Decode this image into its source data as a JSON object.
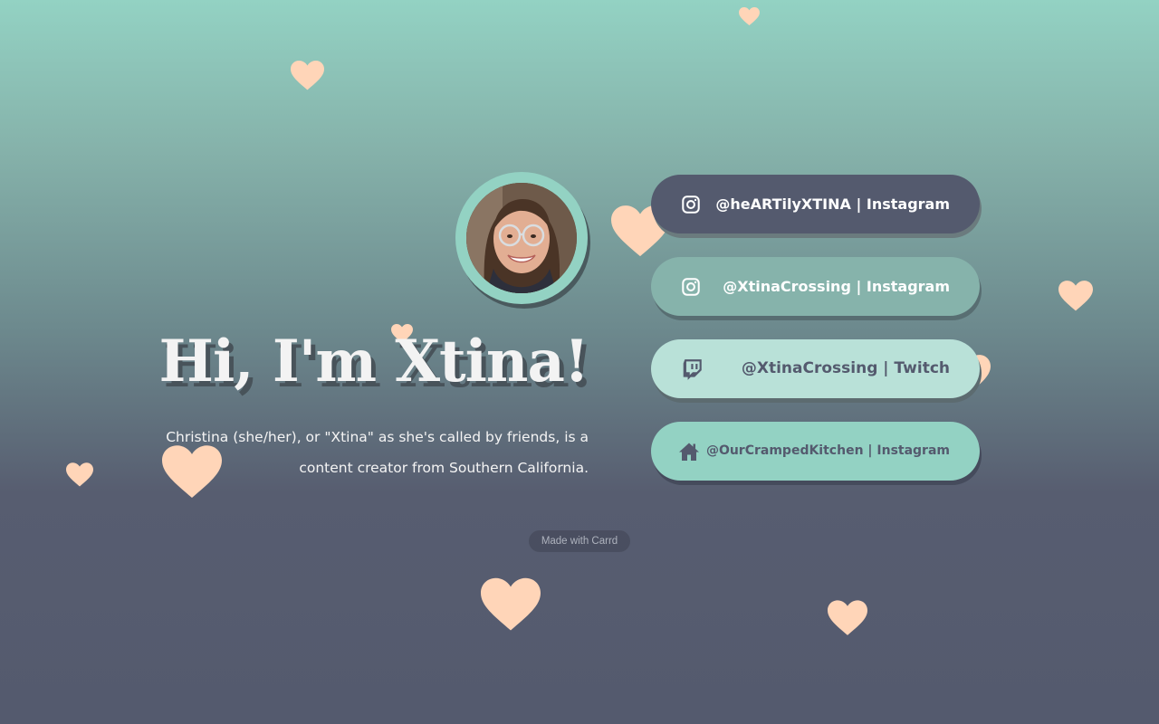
{
  "profile": {
    "headline": "Hi, I'm Xtina!",
    "intro": "Christina (she/her), or \"Xtina\" as she's called by friends, is a content creator from Southern California.",
    "avatar_alt": "Xtina profile photo"
  },
  "links": [
    {
      "label": "@heARTilyXTINA | Instagram",
      "icon": "instagram-icon"
    },
    {
      "label": "@XtinaCrossing | Instagram",
      "icon": "instagram-icon"
    },
    {
      "label": "@XtinaCrossing | Twitch",
      "icon": "twitch-icon"
    },
    {
      "label": "@OurCrampedKitchen | Instagram",
      "icon": "home-icon"
    }
  ],
  "footer": {
    "made_with": "Made with Carrd"
  },
  "colors": {
    "mint": "#93d2c3",
    "slate": "#545a6e",
    "heart": "#ffd5b8",
    "light_mint": "#b9e1d8",
    "sage": "#86b3ab"
  },
  "decorations": {
    "icon": "heart-icon"
  }
}
